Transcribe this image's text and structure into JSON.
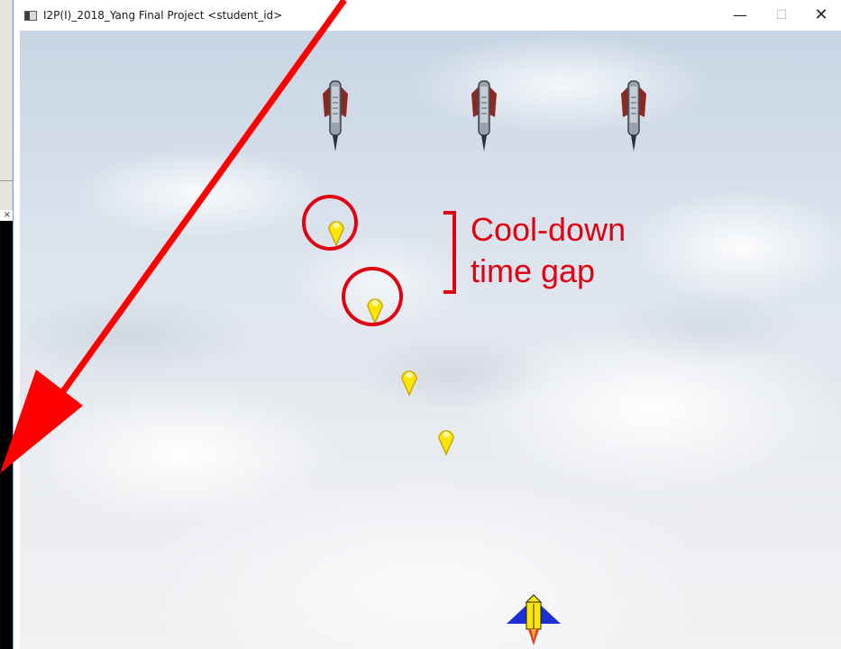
{
  "window": {
    "title": "I2P(I)_2018_Yang Final Project <student_id>",
    "minimize_glyph": "—",
    "maximize_glyph": "☐",
    "close_glyph": "✕"
  },
  "background_console": {
    "close_glyph": "×"
  },
  "game": {
    "enemies": [
      {
        "name": "enemy-ship-1"
      },
      {
        "name": "enemy-ship-2"
      },
      {
        "name": "enemy-ship-3"
      }
    ],
    "bullets_count_shown": 4,
    "player": {
      "name": "player-ship"
    }
  },
  "annotation": {
    "label_line1": "Cool-down",
    "label_line2": "time gap",
    "color": "#e00012"
  },
  "colors": {
    "bullet_fill": "#ffe600",
    "bullet_stroke": "#c8a800",
    "player_body": "#ffe600",
    "player_wings": "#1f2fd6",
    "player_flame": "#e23a1a",
    "arrow": "#ff0000"
  }
}
